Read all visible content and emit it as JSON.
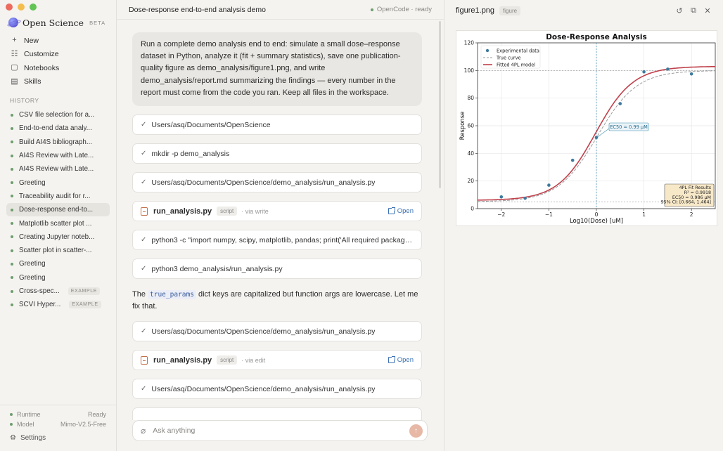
{
  "sidebar": {
    "brand": "Open Science",
    "beta": "BETA",
    "nav": [
      {
        "label": "New",
        "icon": "plus-icon"
      },
      {
        "label": "Customize",
        "icon": "sliders-icon"
      },
      {
        "label": "Notebooks",
        "icon": "notebook-icon"
      },
      {
        "label": "Skills",
        "icon": "book-icon"
      }
    ],
    "history_title": "HISTORY",
    "history": [
      {
        "label": "CSV file selection for a...",
        "badge": ""
      },
      {
        "label": "End-to-end data analy...",
        "badge": ""
      },
      {
        "label": "Build AI4S bibliograph...",
        "badge": ""
      },
      {
        "label": "AI4S Review with Late...",
        "badge": ""
      },
      {
        "label": "AI4S Review with Late...",
        "badge": ""
      },
      {
        "label": "Greeting",
        "badge": ""
      },
      {
        "label": "Traceability audit for r...",
        "badge": ""
      },
      {
        "label": "Dose-response end-to...",
        "badge": "",
        "active": true
      },
      {
        "label": "Matplotlib scatter plot ...",
        "badge": ""
      },
      {
        "label": "Creating Jupyter noteb...",
        "badge": ""
      },
      {
        "label": "Scatter plot in scatter-...",
        "badge": ""
      },
      {
        "label": "Greeting",
        "badge": ""
      },
      {
        "label": "Greeting",
        "badge": ""
      },
      {
        "label": "Cross-spec...",
        "badge": "EXAMPLE"
      },
      {
        "label": "SCVI Hyper...",
        "badge": "EXAMPLE"
      }
    ],
    "footer": {
      "runtime_label": "Runtime",
      "runtime_value": "Ready",
      "model_label": "Model",
      "model_value": "Mimo-V2.5-Free",
      "settings": "Settings"
    }
  },
  "main": {
    "title": "Dose-response end-to-end analysis demo",
    "status": "OpenCode · ready",
    "user_message": "Run a complete demo analysis end to end: simulate a small dose–response dataset in Python, analyze it (fit + summary statistics), save one publication-quality figure as demo_analysis/figure1.png, and write demo_analysis/report.md summarizing the findings — every number in the report must come from the code you ran. Keep all files in the workspace.",
    "steps_a": [
      "Users/asq/Documents/OpenScience",
      "mkdir -p demo_analysis",
      "Users/asq/Documents/OpenScience/demo_analysis/run_analysis.py"
    ],
    "file1": {
      "name": "run_analysis.py",
      "tag": "script",
      "via": "· via write",
      "open": "Open"
    },
    "steps_b": [
      "python3 -c \"import numpy, scipy, matplotlib, pandas; print('All required packages installed')\"",
      "python3 demo_analysis/run_analysis.py"
    ],
    "assistant_pre": "The ",
    "assistant_code": "true_params",
    "assistant_post": " dict keys are capitalized but function args are lowercase. Let me fix that.",
    "steps_c": [
      "Users/asq/Documents/OpenScience/demo_analysis/run_analysis.py"
    ],
    "file2": {
      "name": "run_analysis.py",
      "tag": "script",
      "via": "· via edit",
      "open": "Open"
    },
    "steps_d": [
      "Users/asq/Documents/OpenScience/demo_analysis/run_analysis.py"
    ],
    "composer_placeholder": "Ask anything"
  },
  "right": {
    "title": "figure1.png",
    "tag": "figure"
  },
  "chart_data": {
    "type": "scatter",
    "title": "Dose-Response Analysis",
    "xlabel": "Log10(Dose) [uM]",
    "ylabel": "Response",
    "xlim": [
      -2.5,
      2.5
    ],
    "ylim": [
      0,
      120
    ],
    "xticks": [
      -2,
      -1,
      0,
      1,
      2
    ],
    "yticks": [
      0,
      20,
      40,
      60,
      80,
      100,
      120
    ],
    "grid": true,
    "legend_position": "top-left",
    "series": [
      {
        "name": "Experimental data",
        "kind": "points",
        "color": "#3d7a9e",
        "x": [
          -2,
          -1.5,
          -1,
          -0.5,
          0,
          0.5,
          1,
          1.5,
          2
        ],
        "y": [
          8.5,
          7.5,
          17,
          35,
          51.5,
          76,
          99,
          101,
          97.5
        ]
      },
      {
        "name": "True curve",
        "kind": "dashed",
        "color": "#9a9a9a",
        "model": {
          "bottom": 5,
          "top": 100,
          "logEC50": 0.02,
          "hill": 1.05
        }
      },
      {
        "name": "Fitted 4PL model",
        "kind": "line",
        "color": "#c0404b",
        "model": {
          "bottom": 6,
          "top": 103,
          "logEC50": -0.02,
          "hill": 1.1
        }
      }
    ],
    "reference_lines": {
      "x": 0,
      "y_top": 100,
      "y_bottom": 5
    },
    "annotation": "EC50 = 0.99 μM",
    "fit_box": {
      "title": "4PL Fit Results",
      "lines": [
        "R² = 0.9918",
        "EC50 = 0.986 μM",
        "95% CI: [0.664, 1.464]"
      ]
    }
  }
}
